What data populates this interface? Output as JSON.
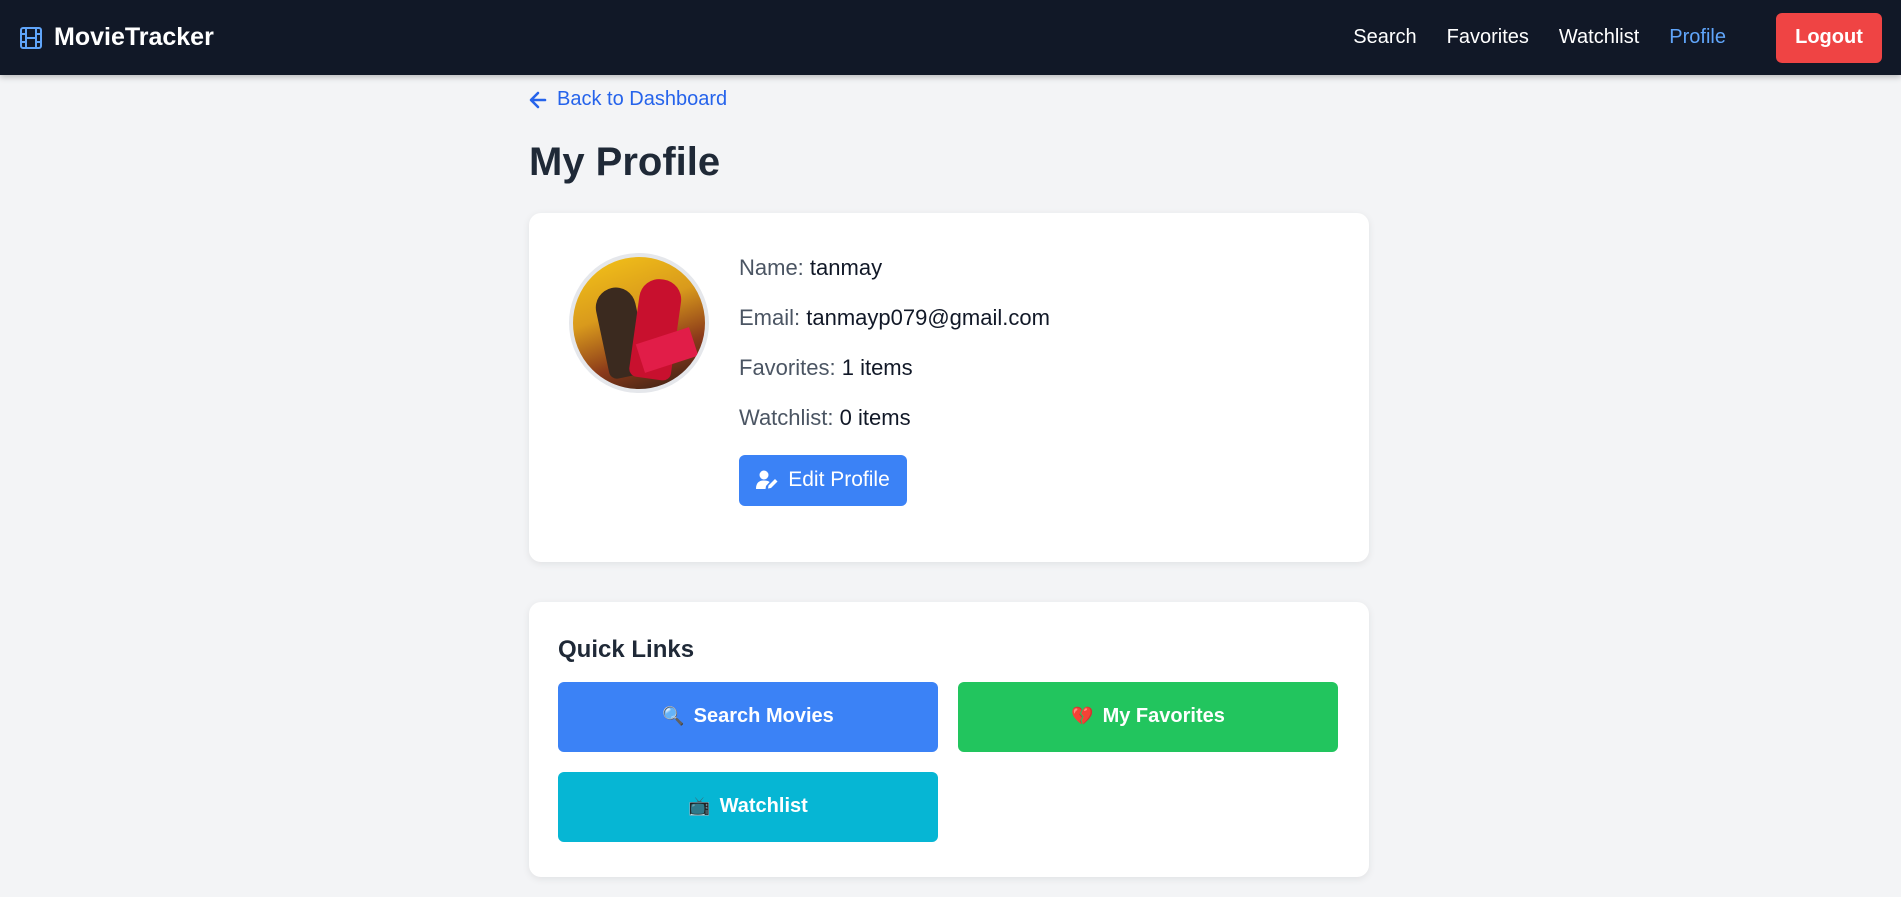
{
  "navbar": {
    "brand": "MovieTracker",
    "links": [
      "Search",
      "Favorites",
      "Watchlist",
      "Profile"
    ],
    "active_link": "Profile",
    "logout_label": "Logout"
  },
  "back_link": "Back to Dashboard",
  "page_title": "My Profile",
  "profile": {
    "name_label": "Name:",
    "name": "tanmay",
    "email_label": "Email:",
    "email": "tanmayp079@gmail.com",
    "favorites_label": "Favorites:",
    "favorites": "1 items",
    "watchlist_label": "Watchlist:",
    "watchlist": "0 items",
    "edit_label": "Edit Profile"
  },
  "quick_links": {
    "title": "Quick Links",
    "search_icon": "🔍",
    "search_label": "Search Movies",
    "favorites_icon": "💔",
    "favorites_label": "My Favorites",
    "watchlist_icon": "📺",
    "watchlist_label": "Watchlist"
  },
  "colors": {
    "navbar": "#111827",
    "accent": "#3b82f6",
    "active_link": "#60a5fa",
    "logout": "#ef4444",
    "favorites_button": "#22c55e",
    "watchlist_button": "#06b6d4"
  },
  "icons": {
    "brand": "film-icon",
    "back": "arrow-left-icon",
    "edit": "user-edit-icon"
  }
}
